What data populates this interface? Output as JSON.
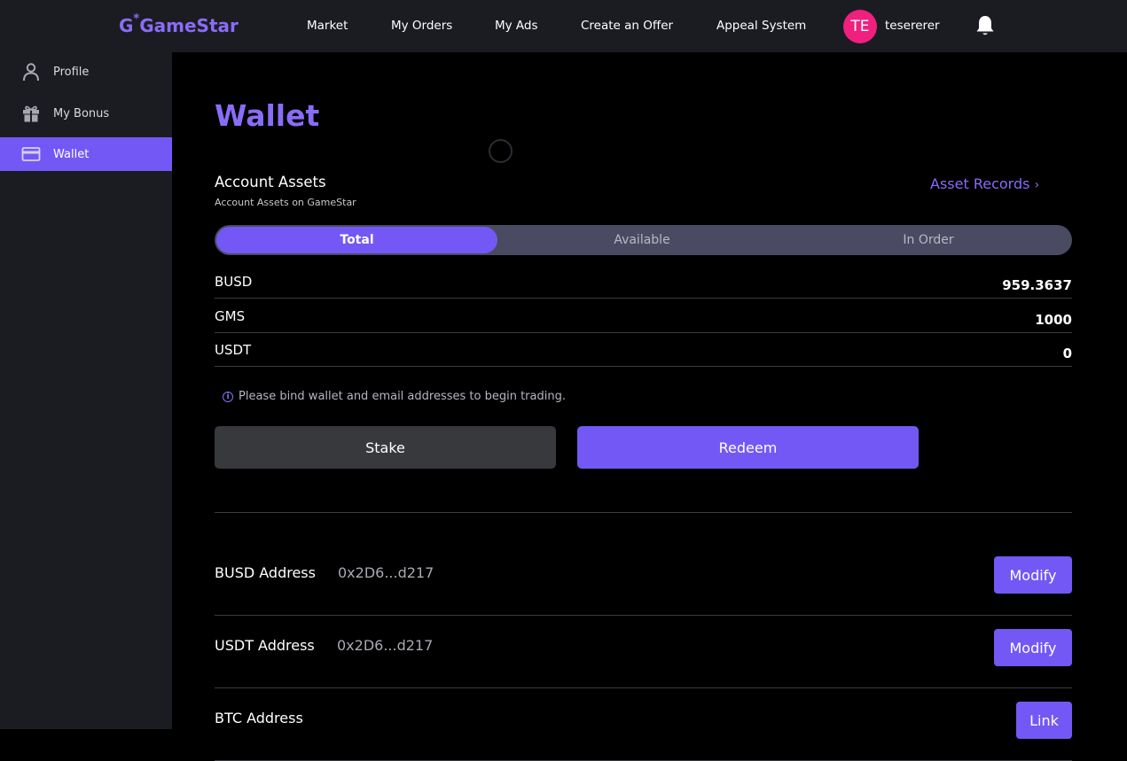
{
  "header": {
    "logo_g": "G",
    "logo_star": "*",
    "logo_text": "GameStar",
    "nav": [
      "Market",
      "My Orders",
      "My Ads",
      "Create an Offer",
      "Appeal System"
    ],
    "avatar_initials": "TE",
    "username": "tesererer",
    "bell_icon": "bell-icon"
  },
  "sidebar": {
    "items": [
      {
        "label": "Profile",
        "icon": "person-icon"
      },
      {
        "label": "My Bonus",
        "icon": "gift-icon"
      },
      {
        "label": "Wallet",
        "icon": "card-icon",
        "active": true
      }
    ]
  },
  "wallet": {
    "title": "Wallet",
    "section_title": "Account Assets",
    "section_subtitle": "Account Assets on GameStar",
    "asset_records": "Asset Records",
    "tabs": [
      "Total",
      "Available",
      "In Order"
    ],
    "active_tab": "Total",
    "assets": [
      {
        "name": "BUSD",
        "value": "959.3637"
      },
      {
        "name": "GMS",
        "value": "1000"
      },
      {
        "name": "USDT",
        "value": "0"
      }
    ],
    "notice": "Please bind wallet and email addresses to begin trading.",
    "stake_label": "Stake",
    "redeem_label": "Redeem",
    "addresses": [
      {
        "label": "BUSD Address",
        "value": "0x2D6...d217",
        "action": "Modify"
      },
      {
        "label": "USDT Address",
        "value": "0x2D6...d217",
        "action": "Modify"
      },
      {
        "label": "BTC Address",
        "value": "",
        "action": "Link"
      }
    ]
  },
  "colors": {
    "accent": "#7458f5",
    "accent_text": "#8a6cf7",
    "avatar": "#f0207e",
    "panel": "#1b1c21",
    "background": "#000000"
  }
}
